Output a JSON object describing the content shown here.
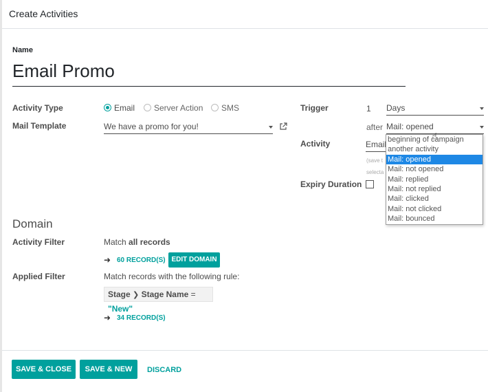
{
  "dialog": {
    "title": "Create Activities"
  },
  "name": {
    "label": "Name",
    "value": "Email Promo"
  },
  "activity_type": {
    "label": "Activity Type",
    "options": [
      "Email",
      "Server Action",
      "SMS"
    ],
    "selected": "Email"
  },
  "mail_template": {
    "label": "Mail Template",
    "value": "We have a promo for you!"
  },
  "trigger": {
    "label": "Trigger",
    "count": "1",
    "unit": "Days",
    "after_label": "after",
    "after_value": "Mail: opened"
  },
  "activity": {
    "label": "Activity",
    "value": "Email",
    "hint1": "(save t",
    "hint2": "selecta"
  },
  "expiry": {
    "label": "Expiry Duration"
  },
  "dropdown_options": [
    "beginning of campaign",
    "another activity",
    "Mail: opened",
    "Mail: not opened",
    "Mail: replied",
    "Mail: not replied",
    "Mail: clicked",
    "Mail: not clicked",
    "Mail: bounced"
  ],
  "dropdown_selected_index": 2,
  "domain": {
    "title": "Domain",
    "activity_filter_label": "Activity Filter",
    "match_prefix": "Match ",
    "match_bold": "all records",
    "records_link": "60 RECORD(S)",
    "edit_button": "EDIT DOMAIN",
    "applied_filter_label": "Applied Filter",
    "applied_text": "Match records with the following rule:",
    "rule_field1": "Stage",
    "rule_field2": "Stage Name",
    "rule_op": "=",
    "rule_value": "\"New\"",
    "applied_records_link": "34 RECORD(S)"
  },
  "footer": {
    "save_close": "SAVE & CLOSE",
    "save_new": "SAVE & NEW",
    "discard": "DISCARD"
  },
  "colors": {
    "accent": "#00a09d",
    "selected_option": "#1e88e5"
  }
}
